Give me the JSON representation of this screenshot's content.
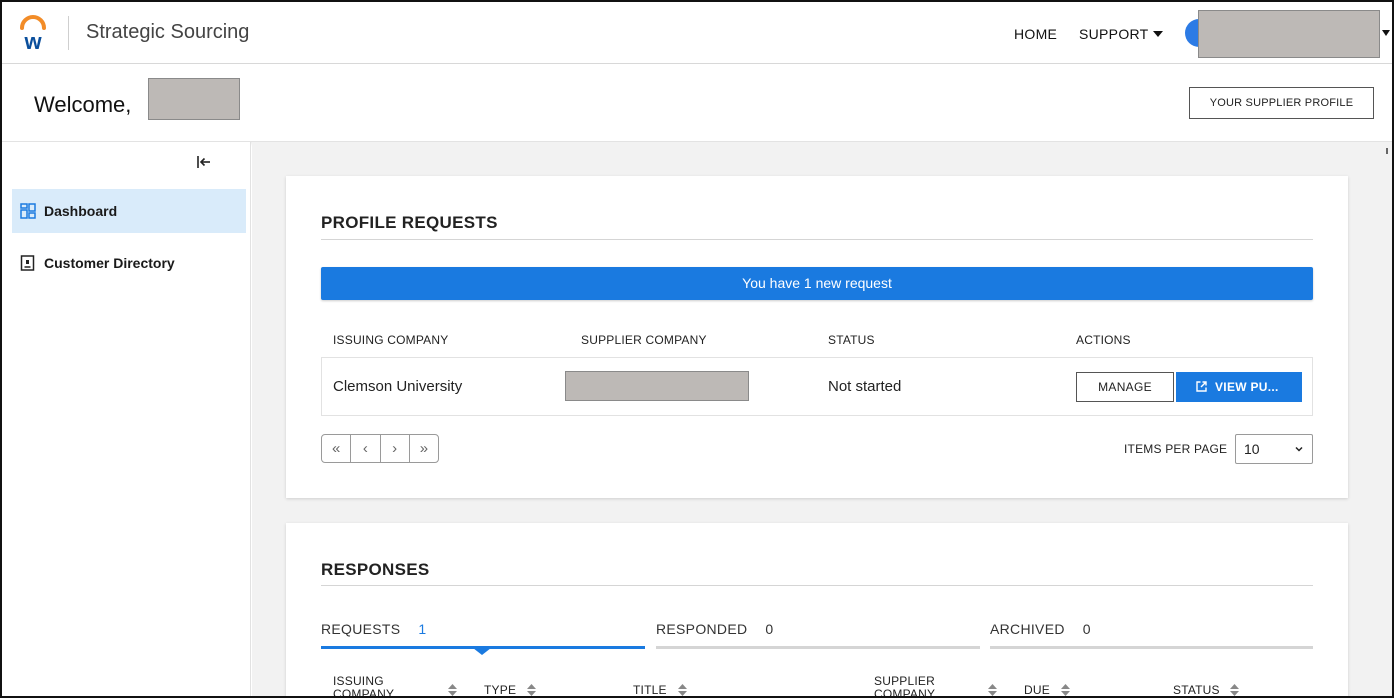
{
  "topbar": {
    "app_title": "Strategic Sourcing",
    "nav_home": "HOME",
    "nav_support": "SUPPORT",
    "brand_color": "#f28c28",
    "logo_letter": "w"
  },
  "welcome": {
    "text": "Welcome,",
    "profile_button": "YOUR SUPPLIER PROFILE"
  },
  "sidebar": {
    "items": [
      {
        "label": "Dashboard",
        "icon": "dashboard-icon",
        "active": true
      },
      {
        "label": "Customer Directory",
        "icon": "directory-icon",
        "active": false
      }
    ]
  },
  "profile_requests": {
    "title": "PROFILE REQUESTS",
    "banner": "You have 1 new request",
    "columns": [
      "ISSUING COMPANY",
      "SUPPLIER COMPANY",
      "STATUS",
      "ACTIONS"
    ],
    "rows": [
      {
        "issuing_company": "Clemson University",
        "status": "Not started"
      }
    ],
    "manage_label": "MANAGE",
    "view_label": "VIEW PU...",
    "pager": [
      "«",
      "‹",
      "›",
      "»"
    ],
    "items_per_page_label": "ITEMS PER PAGE",
    "items_per_page_value": "10"
  },
  "responses": {
    "title": "RESPONSES",
    "tabs": [
      {
        "label": "REQUESTS",
        "count": "1",
        "active": true
      },
      {
        "label": "RESPONDED",
        "count": "0",
        "active": false
      },
      {
        "label": "ARCHIVED",
        "count": "0",
        "active": false
      }
    ],
    "columns": [
      "ISSUING COMPANY",
      "TYPE",
      "TITLE",
      "SUPPLIER COMPANY",
      "DUE",
      "STATUS"
    ]
  },
  "colors": {
    "accent": "#1a7ae0",
    "active_nav_bg": "#d9ebfa",
    "redaction": "#bdb9b6"
  }
}
